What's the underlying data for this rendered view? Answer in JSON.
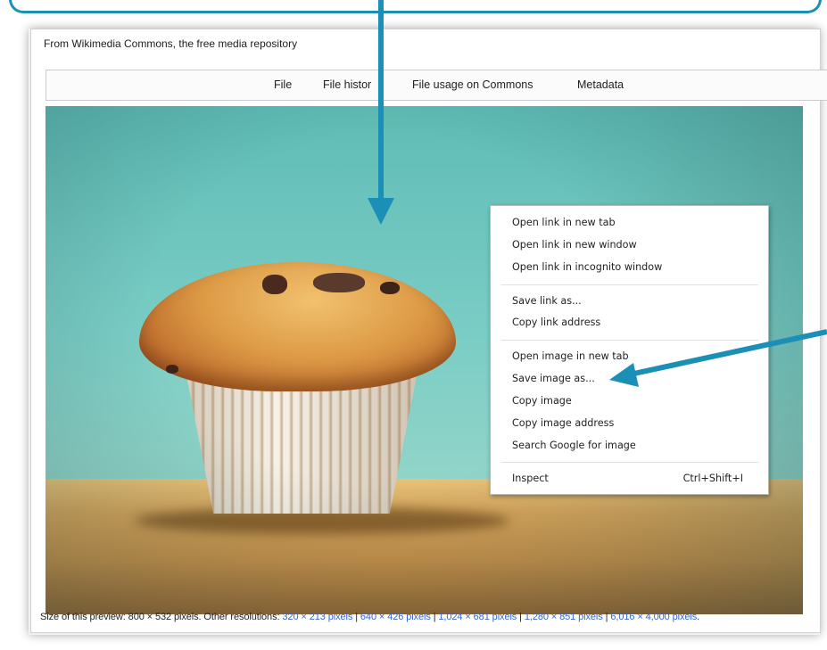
{
  "page": {
    "source_line": "From Wikimedia Commons, the free media repository",
    "tabs": [
      "File",
      "File histor",
      "File usage on Commons",
      "Metadata"
    ]
  },
  "context_menu": {
    "groups": [
      [
        "Open link in new tab",
        "Open link in new window",
        "Open link in incognito window"
      ],
      [
        "Save link as...",
        "Copy link address"
      ],
      [
        "Open image in new tab",
        "Save image as...",
        "Copy image",
        "Copy image address",
        "Search Google for image"
      ]
    ],
    "inspect": {
      "label": "Inspect",
      "shortcut": "Ctrl+Shift+I"
    }
  },
  "caption": {
    "prefix": "Size of this preview: 800 × 532 pixels. Other resolutions:",
    "resolutions": [
      "320 × 213 pixels",
      "640 × 426 pixels",
      "1,024 × 681 pixels",
      "1,280 × 851 pixels",
      "6,016 × 4,000 pixels"
    ],
    "suffix": "."
  },
  "colors": {
    "callout_arrow": "#1b8fb5",
    "link": "#3366cc"
  }
}
